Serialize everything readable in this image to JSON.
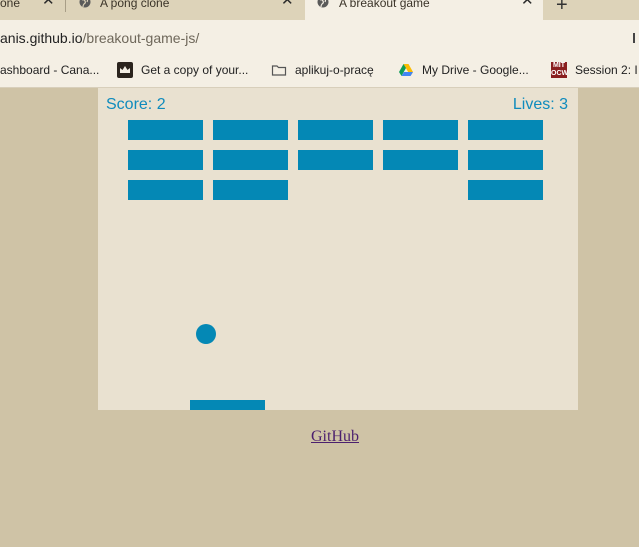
{
  "browser": {
    "tabs": [
      {
        "title": "one",
        "active": false
      },
      {
        "title": "A pong clone",
        "active": false
      },
      {
        "title": "A breakout game",
        "active": true
      }
    ],
    "url_host": "anis.github.io",
    "url_path": "/breakout-game-js/",
    "bookmarks": [
      {
        "label": "ashboard - Cana...",
        "icon": "canvas-icon"
      },
      {
        "label": "Get a copy of your...",
        "icon": "crown-icon"
      },
      {
        "label": "aplikuj-o-pracę",
        "icon": "folder-icon"
      },
      {
        "label": "My Drive - Google...",
        "icon": "google-drive-icon"
      },
      {
        "label": "Session 2: I",
        "icon": "mit-ocw-icon"
      }
    ]
  },
  "game": {
    "score_text": "Score: 2",
    "lives_text": "Lives: 3",
    "score": 2,
    "lives": 3,
    "brick_color": "#0488b5",
    "background_color": "#e9e1d0",
    "bricks": [
      [
        true,
        true,
        true,
        true,
        true
      ],
      [
        true,
        true,
        true,
        true,
        true
      ],
      [
        true,
        true,
        false,
        false,
        true
      ]
    ]
  },
  "footer": {
    "github_label": "GitHub"
  }
}
